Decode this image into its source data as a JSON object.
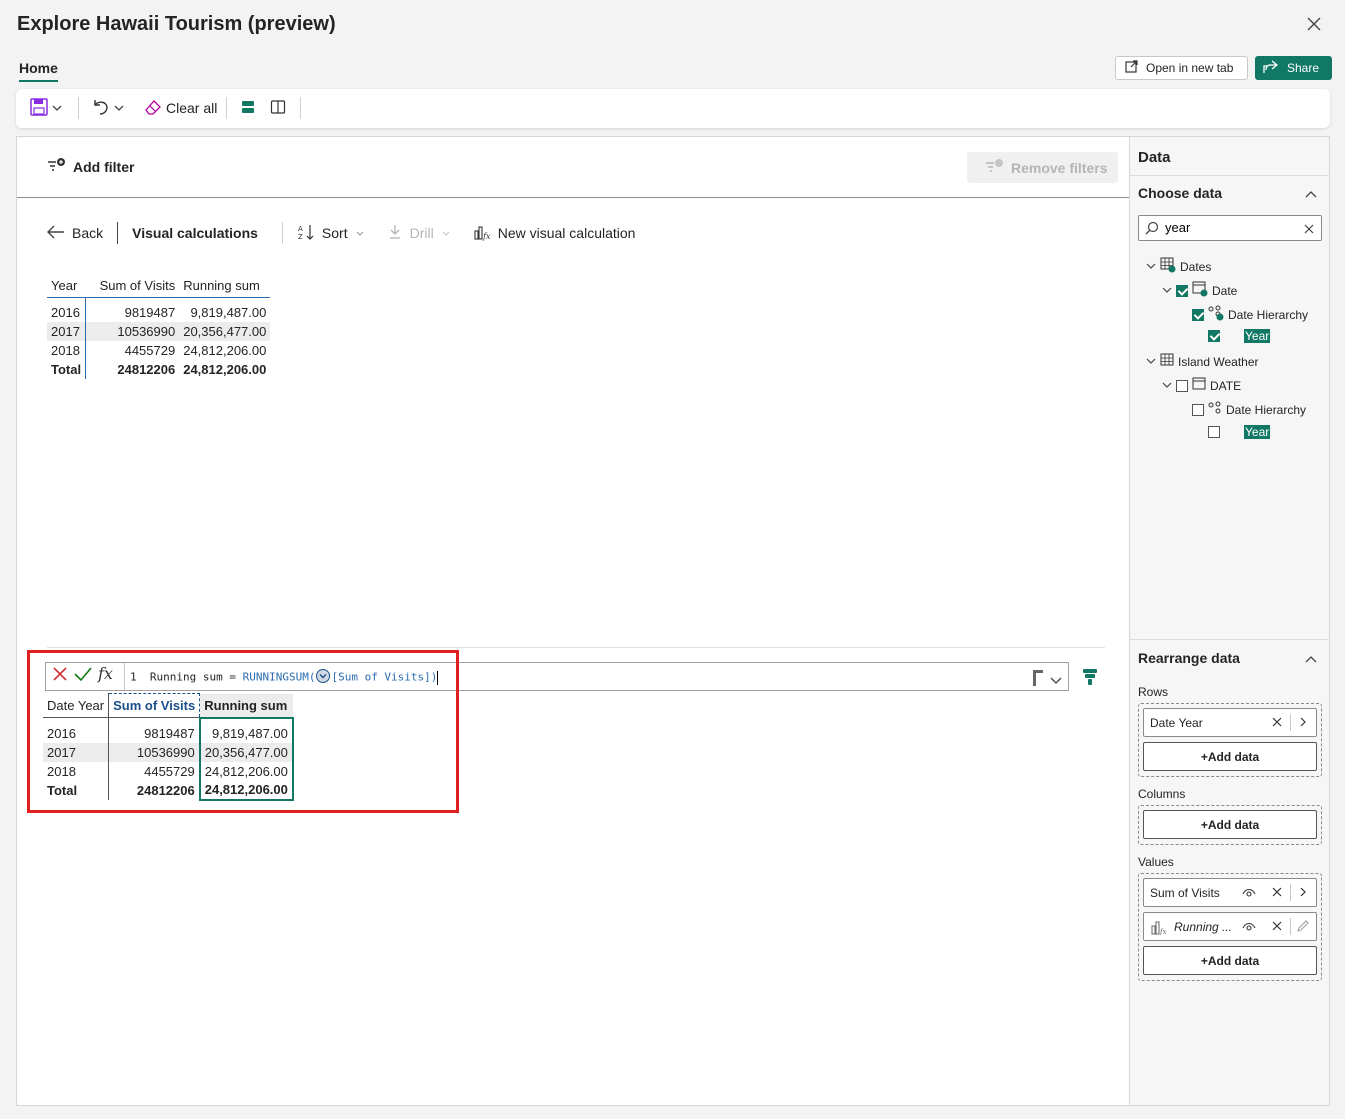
{
  "window": {
    "title": "Explore Hawaii Tourism (preview)"
  },
  "tabs": {
    "home": "Home"
  },
  "header_actions": {
    "open_new_tab": "Open in new tab",
    "share": "Share"
  },
  "toolbar": {
    "clear_all": "Clear all"
  },
  "filters": {
    "add_filter": "Add filter",
    "remove_filters": "Remove filters"
  },
  "visual_bar": {
    "back": "Back",
    "visual_calculations": "Visual calculations",
    "sort": "Sort",
    "drill": "Drill",
    "new_visual_calc": "New visual calculation"
  },
  "top_table": {
    "headers": [
      "Year",
      "Sum of Visits",
      "Running sum"
    ],
    "rows": [
      [
        "2016",
        "9819487",
        "9,819,487.00"
      ],
      [
        "2017",
        "10536990",
        "20,356,477.00"
      ],
      [
        "2018",
        "4455729",
        "24,812,206.00"
      ]
    ],
    "total": [
      "Total",
      "24812206",
      "24,812,206.00"
    ]
  },
  "formula": {
    "line_number": "1",
    "prefix": "Running sum = ",
    "function": "RUNNINGSUM(",
    "arg": "[Sum of Visits]",
    "suffix": ")"
  },
  "bottom_table": {
    "headers": [
      "Date Year",
      "Sum of Visits",
      "Running sum"
    ],
    "rows": [
      [
        "2016",
        "9819487",
        "9,819,487.00"
      ],
      [
        "2017",
        "10536990",
        "20,356,477.00"
      ],
      [
        "2018",
        "4455729",
        "24,812,206.00"
      ]
    ],
    "total": [
      "Total",
      "24812206",
      "24,812,206.00"
    ]
  },
  "data_pane": {
    "title": "Data",
    "choose_data": "Choose data",
    "search_value": "year",
    "tree": {
      "dates": "Dates",
      "date": "Date",
      "date_hierarchy": "Date Hierarchy",
      "year": "Year",
      "island_weather": "Island Weather",
      "date_caps": "DATE",
      "date_hierarchy_2": "Date Hierarchy",
      "year_2": "Year"
    },
    "rearrange": "Rearrange data",
    "rows_label": "Rows",
    "rows_pill": "Date Year",
    "columns_label": "Columns",
    "values_label": "Values",
    "value_pill_1": "Sum of Visits",
    "value_pill_2": "Running ...",
    "add_data": "+Add data"
  },
  "colors": {
    "accent": "#117865",
    "highlight_box": "#e02020",
    "link_blue": "#2b6cb0"
  }
}
